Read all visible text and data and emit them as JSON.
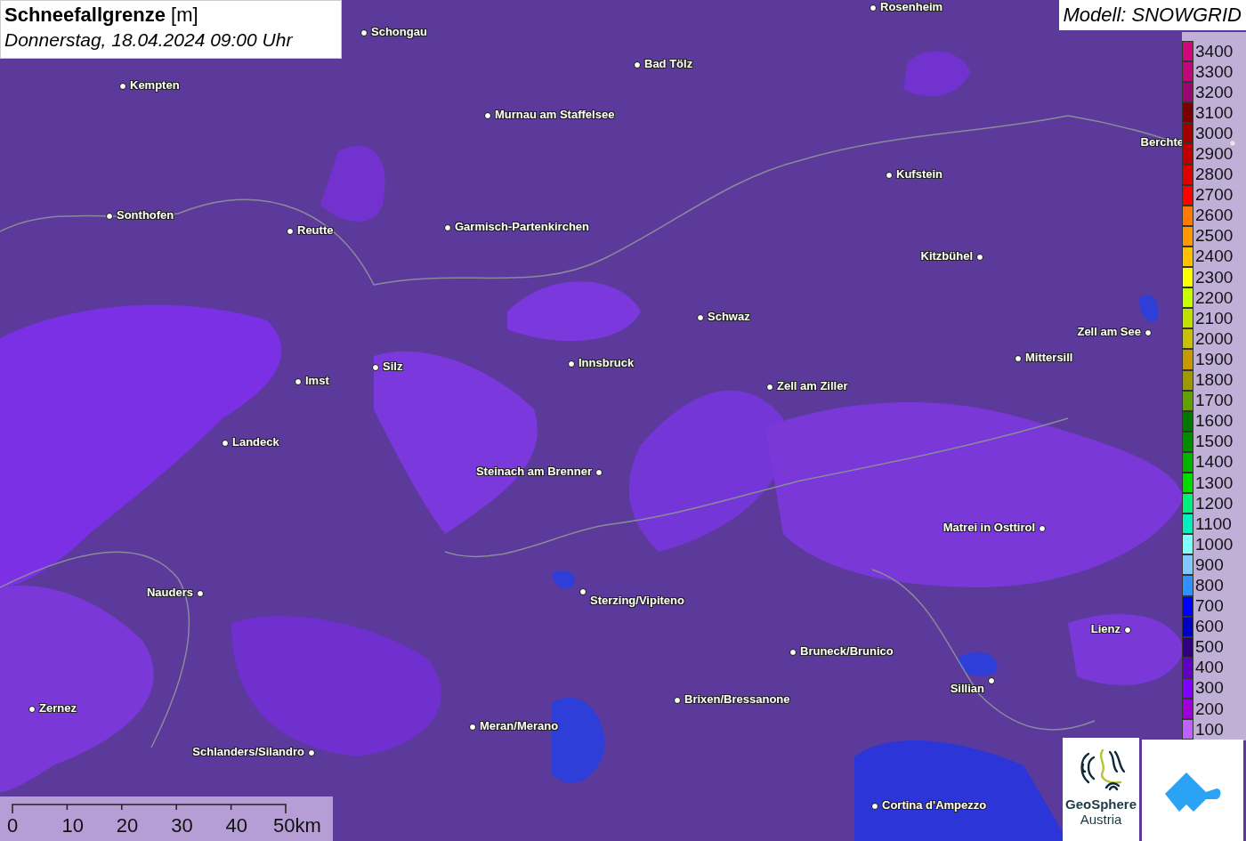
{
  "title": {
    "parameter": "Schneefallgrenze",
    "unit": "[m]",
    "datetime": "Donnerstag, 18.04.2024 09:00 Uhr"
  },
  "model_label": "Modell: SNOWGRID",
  "cities": [
    {
      "name": "Rosenheim"
    },
    {
      "name": "Schongau"
    },
    {
      "name": "Bad Tölz"
    },
    {
      "name": "Kempten"
    },
    {
      "name": "Murnau am Staffelsee"
    },
    {
      "name": "Berchte"
    },
    {
      "name": "Kufstein"
    },
    {
      "name": "Sonthofen"
    },
    {
      "name": "Reutte"
    },
    {
      "name": "Garmisch-Partenkirchen"
    },
    {
      "name": "Kitzbühel"
    },
    {
      "name": "Schwaz"
    },
    {
      "name": "Zell am See"
    },
    {
      "name": "Mittersill"
    },
    {
      "name": "Silz"
    },
    {
      "name": "Innsbruck"
    },
    {
      "name": "Imst"
    },
    {
      "name": "Zell am Ziller"
    },
    {
      "name": "Landeck"
    },
    {
      "name": "Steinach am Brenner"
    },
    {
      "name": "Matrei in Osttirol"
    },
    {
      "name": "Nauders"
    },
    {
      "name": "Sterzing/Vipiteno"
    },
    {
      "name": "Lienz"
    },
    {
      "name": "Bruneck/Brunico"
    },
    {
      "name": "Sillian"
    },
    {
      "name": "Zernez"
    },
    {
      "name": "Brixen/Bressanone"
    },
    {
      "name": "Meran/Merano"
    },
    {
      "name": "Schlanders/Silandro"
    },
    {
      "name": "Cortina d'Ampezzo"
    }
  ],
  "legend": [
    {
      "value": "3400",
      "color": "#d0087a"
    },
    {
      "value": "3300",
      "color": "#c00878"
    },
    {
      "value": "3200",
      "color": "#98086e"
    },
    {
      "value": "3100",
      "color": "#780000"
    },
    {
      "value": "3000",
      "color": "#a00000"
    },
    {
      "value": "2900",
      "color": "#c00000"
    },
    {
      "value": "2800",
      "color": "#e00000"
    },
    {
      "value": "2700",
      "color": "#ff0000"
    },
    {
      "value": "2600",
      "color": "#ff7800"
    },
    {
      "value": "2500",
      "color": "#ff9800"
    },
    {
      "value": "2400",
      "color": "#ffc000"
    },
    {
      "value": "2300",
      "color": "#ffff00"
    },
    {
      "value": "2200",
      "color": "#c8ff00"
    },
    {
      "value": "2100",
      "color": "#c0e000"
    },
    {
      "value": "2000",
      "color": "#c8c000"
    },
    {
      "value": "1900",
      "color": "#c89800"
    },
    {
      "value": "1800",
      "color": "#a09800"
    },
    {
      "value": "1700",
      "color": "#60a000"
    },
    {
      "value": "1600",
      "color": "#007800"
    },
    {
      "value": "1500",
      "color": "#008c00"
    },
    {
      "value": "1400",
      "color": "#00b400"
    },
    {
      "value": "1300",
      "color": "#00dc00"
    },
    {
      "value": "1200",
      "color": "#00f080"
    },
    {
      "value": "1100",
      "color": "#00f0c0"
    },
    {
      "value": "1000",
      "color": "#80ffff"
    },
    {
      "value": "900",
      "color": "#80c8ff"
    },
    {
      "value": "800",
      "color": "#3090ff"
    },
    {
      "value": "700",
      "color": "#0000ff"
    },
    {
      "value": "600",
      "color": "#0000c0"
    },
    {
      "value": "500",
      "color": "#300080"
    },
    {
      "value": "400",
      "color": "#6000c0"
    },
    {
      "value": "300",
      "color": "#8000ff"
    },
    {
      "value": "200",
      "color": "#a000d8"
    },
    {
      "value": "100",
      "color": "#c060ff"
    }
  ],
  "scale_bar": {
    "ticks": [
      "0",
      "10",
      "20",
      "30",
      "40",
      "50km"
    ]
  },
  "logos": {
    "geosphere_name": "GeoSphere",
    "geosphere_country": "Austria"
  }
}
